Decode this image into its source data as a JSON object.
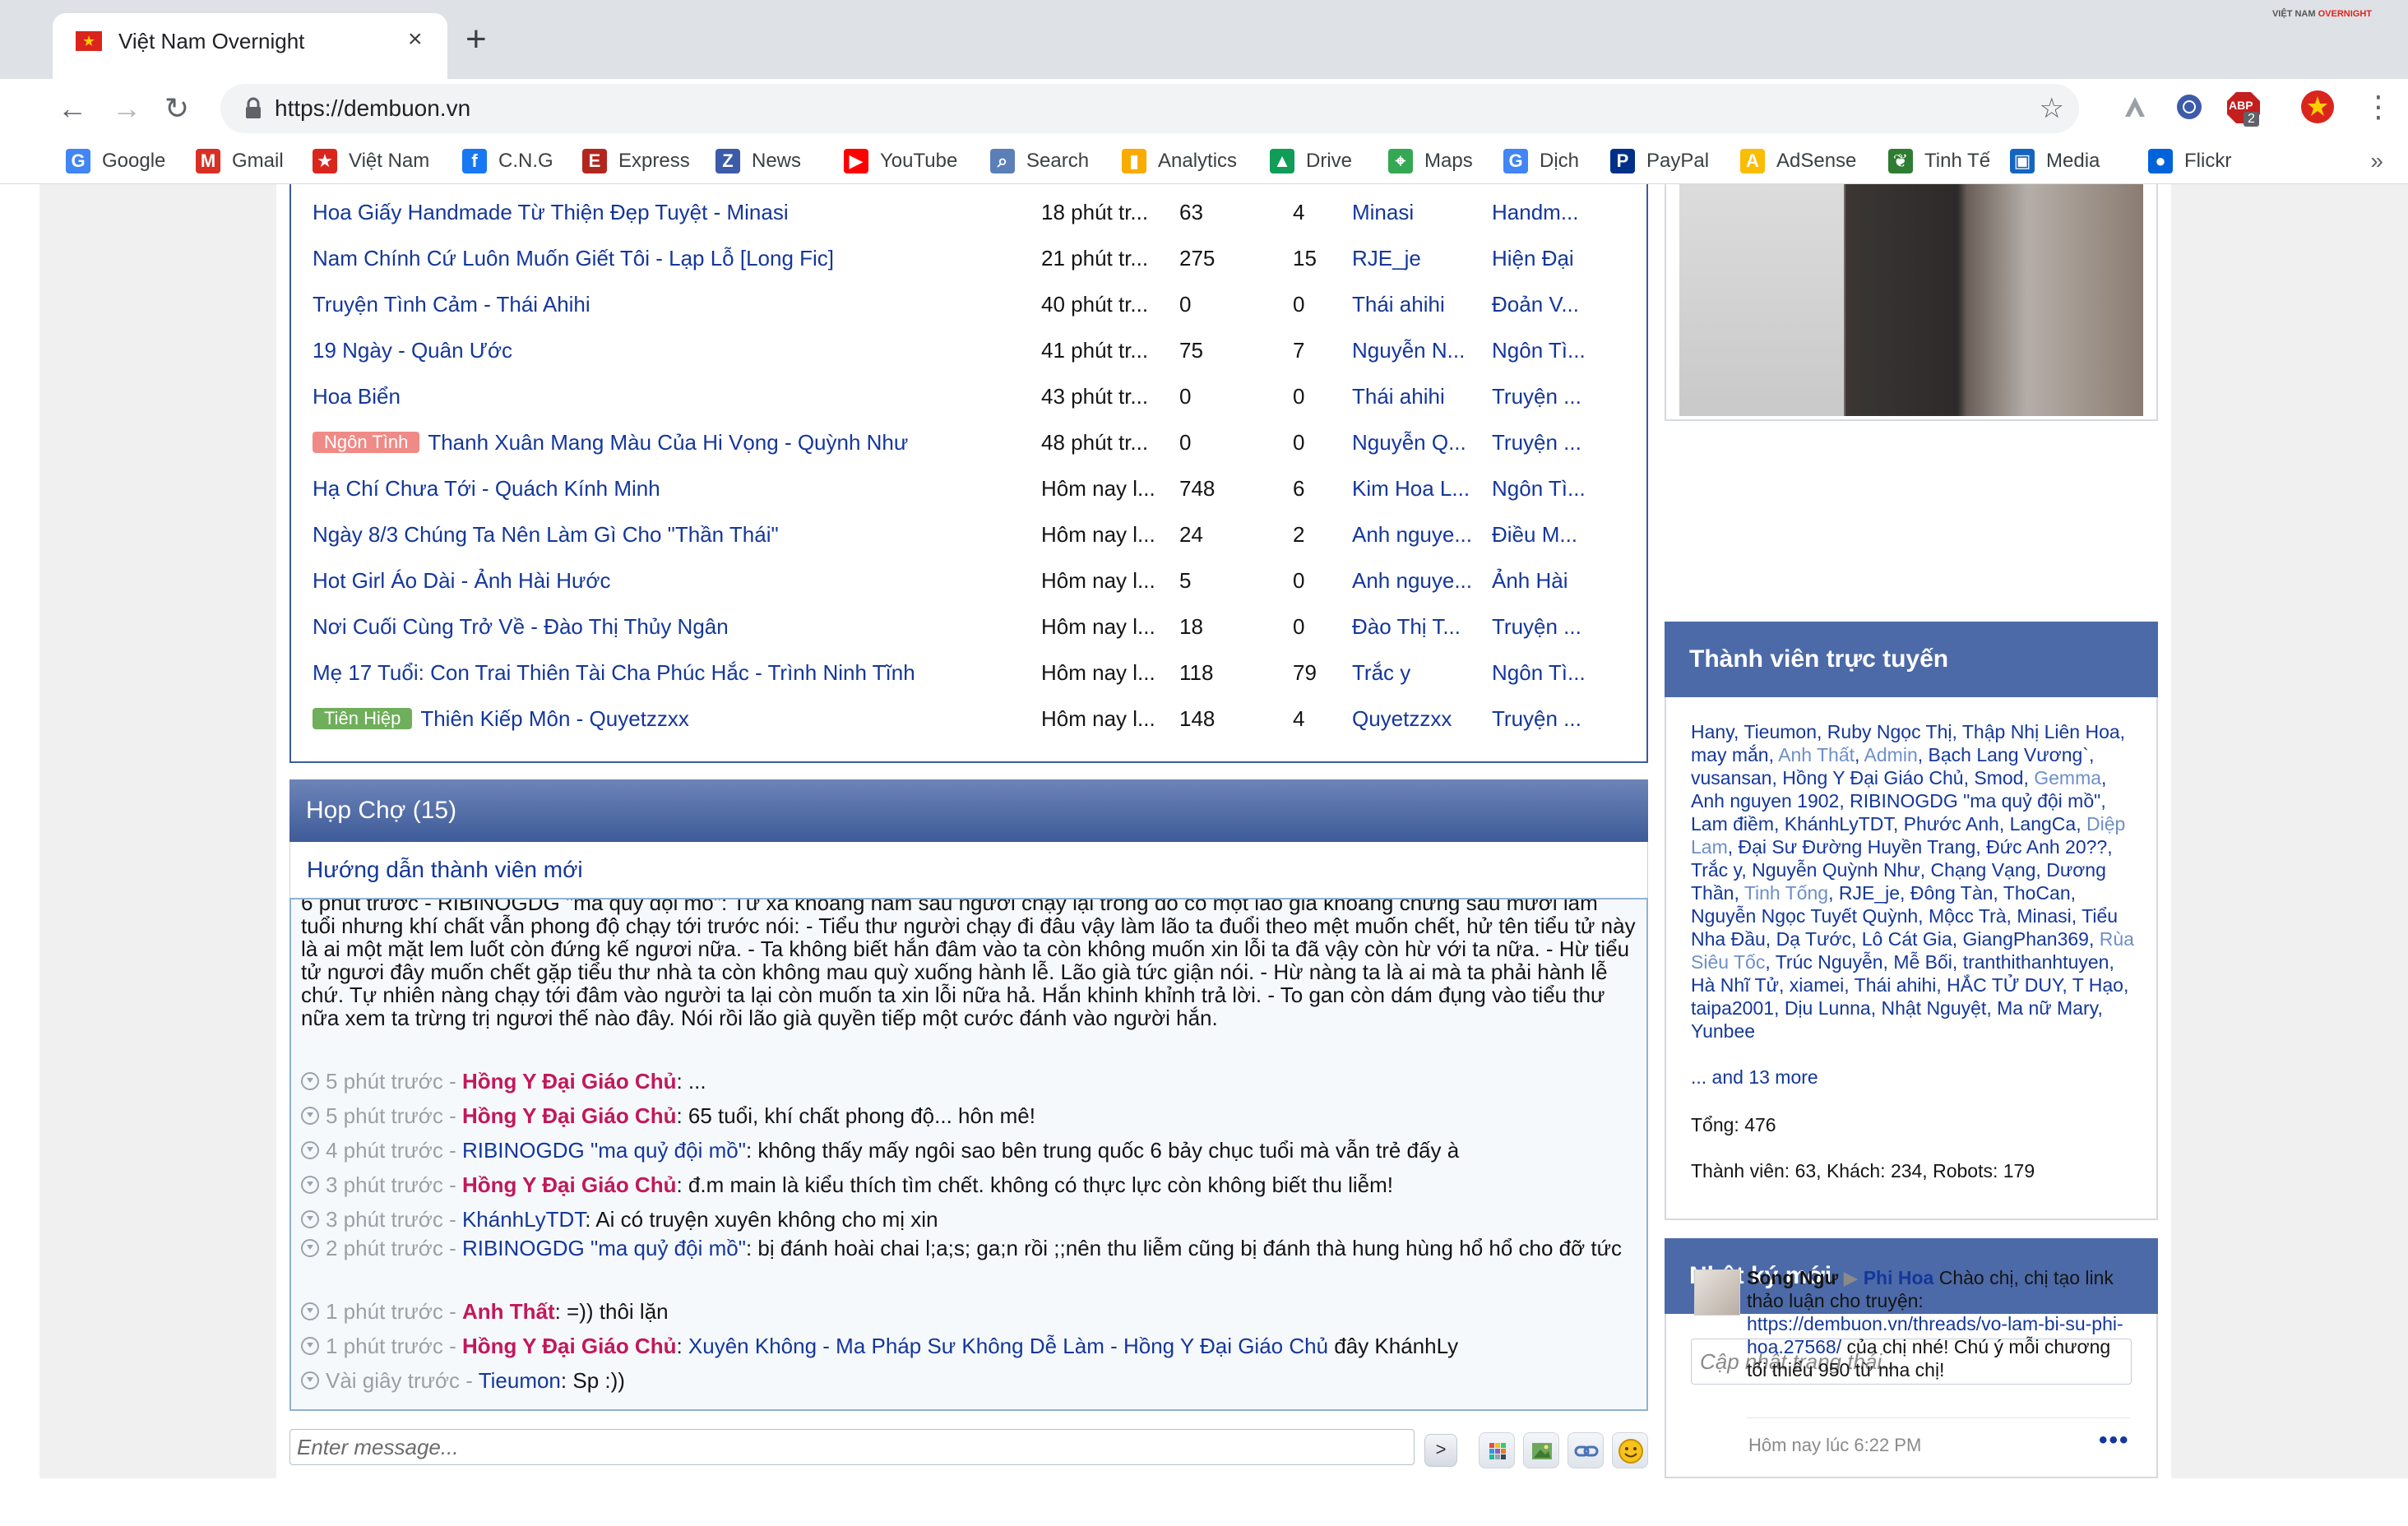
{
  "browser": {
    "tab_title": "Việt Nam Overnight",
    "tab_close": "×",
    "new_tab": "+",
    "url": "https://dembuon.vn",
    "corner_badge_a": "VIỆT NAM",
    "corner_badge_b": "OVERNIGHT",
    "ext_badge_count": "2",
    "ext_badge_label": "ABP",
    "bookmarks_more": "»",
    "bookmarks": [
      {
        "label": "Google",
        "icon": "google-icon",
        "color": "#4285f4",
        "glyph": "G"
      },
      {
        "label": "Gmail",
        "icon": "gmail-icon",
        "color": "#d93025",
        "glyph": "M"
      },
      {
        "label": "Việt Nam",
        "icon": "vietnam-flag-icon",
        "color": "#da251d",
        "glyph": "★"
      },
      {
        "label": "C.N.G",
        "icon": "facebook-icon",
        "color": "#1877f2",
        "glyph": "f"
      },
      {
        "label": "Express",
        "icon": "express-icon",
        "color": "#b3261e",
        "glyph": "E"
      },
      {
        "label": "News",
        "icon": "news-icon",
        "color": "#3c5ba9",
        "glyph": "Z"
      },
      {
        "label": "YouTube",
        "icon": "youtube-icon",
        "color": "#ff0000",
        "glyph": "▶"
      },
      {
        "label": "Search",
        "icon": "search-icon",
        "color": "#5b7fb8",
        "glyph": "⌕"
      },
      {
        "label": "Analytics",
        "icon": "analytics-icon",
        "color": "#f9ab00",
        "glyph": "▮"
      },
      {
        "label": "Drive",
        "icon": "drive-icon",
        "color": "#0f9d58",
        "glyph": "▲"
      },
      {
        "label": "Maps",
        "icon": "maps-icon",
        "color": "#34a853",
        "glyph": "⌖"
      },
      {
        "label": "Dịch",
        "icon": "translate-icon",
        "color": "#4285f4",
        "glyph": "G"
      },
      {
        "label": "PayPal",
        "icon": "paypal-icon",
        "color": "#003087",
        "glyph": "P"
      },
      {
        "label": "AdSense",
        "icon": "adsense-icon",
        "color": "#fbbc04",
        "glyph": "A"
      },
      {
        "label": "Tinh Tế",
        "icon": "tinhte-icon",
        "color": "#2e7d32",
        "glyph": "❦"
      },
      {
        "label": "Media",
        "icon": "media-icon",
        "color": "#1565c0",
        "glyph": "▣"
      },
      {
        "label": "Flickr",
        "icon": "flickr-icon",
        "color": "#0063dc",
        "glyph": "●"
      }
    ]
  },
  "threads": [
    {
      "title": "Hoa Giấy Handmade Từ Thiện Đẹp Tuyệt - Minasi",
      "prefix": "",
      "time": "18 phút tr...",
      "replies": "63",
      "views": "4",
      "user": "Minasi",
      "forum": "Handm..."
    },
    {
      "title": "Nam Chính Cứ Luôn Muốn Giết Tôi - Lạp Lỗ [Long Fic]",
      "prefix": "",
      "time": "21 phút tr...",
      "replies": "275",
      "views": "15",
      "user": "RJE_je",
      "forum": "Hiện Đại"
    },
    {
      "title": "Truyện Tình Cảm - Thái Ahihi",
      "prefix": "",
      "time": "40 phút tr...",
      "replies": "0",
      "views": "0",
      "user": "Thái ahihi",
      "forum": "Đoản V..."
    },
    {
      "title": "19 Ngày - Quân Ước",
      "prefix": "",
      "time": "41 phút tr...",
      "replies": "75",
      "views": "7",
      "user": "Nguyễn N...",
      "forum": "Ngôn Tì..."
    },
    {
      "title": "Hoa Biển",
      "prefix": "",
      "time": "43 phút tr...",
      "replies": "0",
      "views": "0",
      "user": "Thái ahihi",
      "forum": "Truyện ..."
    },
    {
      "title": "Thanh Xuân Mang Màu Của Hi Vọng - Quỳnh Như",
      "prefix": "Ngôn Tình",
      "prefix_color": "#f08a86",
      "time": "48 phút tr...",
      "replies": "0",
      "views": "0",
      "user": "Nguyễn Q...",
      "forum": "Truyện ..."
    },
    {
      "title": "Hạ Chí Chưa Tới - Quách Kính Minh",
      "prefix": "",
      "time": "Hôm nay l...",
      "replies": "748",
      "views": "6",
      "user": "Kim Hoa L...",
      "forum": "Ngôn Tì..."
    },
    {
      "title": "Ngày 8/3 Chúng Ta Nên Làm Gì Cho \"Thần Thái\"",
      "prefix": "",
      "time": "Hôm nay l...",
      "replies": "24",
      "views": "2",
      "user": "Anh nguye...",
      "forum": "Điều M..."
    },
    {
      "title": "Hot Girl Áo Dài - Ảnh Hài Hước",
      "prefix": "",
      "time": "Hôm nay l...",
      "replies": "5",
      "views": "0",
      "user": "Anh nguye...",
      "forum": "Ảnh Hài"
    },
    {
      "title": "Nơi Cuối Cùng Trở Về - Đào Thị Thủy Ngân",
      "prefix": "",
      "time": "Hôm nay l...",
      "replies": "18",
      "views": "0",
      "user": "Đào Thị T...",
      "forum": "Truyện ..."
    },
    {
      "title": "Mẹ 17 Tuổi: Con Trai Thiên Tài Cha Phúc Hắc - Trình Ninh Tĩnh",
      "prefix": "",
      "time": "Hôm nay l...",
      "replies": "118",
      "views": "79",
      "user": "Trắc y",
      "forum": "Ngôn Tì..."
    },
    {
      "title": "Thiên Kiếp Môn - Quyetzzxx",
      "prefix": "Tiên Hiệp",
      "prefix_color": "#6fae5a",
      "time": "Hôm nay l...",
      "replies": "148",
      "views": "4",
      "user": "Quyetzzxx",
      "forum": "Truyện ..."
    }
  ],
  "chat": {
    "title": "Họp Chợ (15)",
    "guide_link": "Hướng dẫn thành viên mới",
    "long_message": "6 phút trước - RIBINOGDG \"ma quỷ đội mồ\": Từ xa khoảng năm sáu người chạy lại trong đó có một lão già khoảng chừng sáu mươi lăm tuổi nhưng khí chất vẫn phong độ chạy tới trước nói: - Tiểu thư người chạy đi đâu vậy làm lão ta đuổi theo mệt muốn chết, hử tên tiểu tử này là ai một mặt lem luốt còn đứng kế ngươi nữa. - Ta không biết hắn đâm vào ta còn không muốn xin lỗi ta đã vậy còn hừ với ta nữa. - Hừ tiểu tử ngươi đây muốn chết gặp tiểu thư nhà ta còn không mau quỳ xuống hành lễ. Lão già tức giận nói. - Hừ nàng ta là ai mà ta phải hành lễ chứ. Tự nhiên nàng chạy tới đâm vào người ta lại còn muốn ta xin lỗi nữa hả. Hắn khinh khỉnh trả lời. - To gan còn dám đụng vào tiểu thư nữa xem ta trừng trị ngươi thế nào đây. Nói rồi lão già quyền tiếp một cước đánh vào người hắn.",
    "messages": [
      {
        "time": "5 phút trước - ",
        "user": "Hồng Y Đại Giáo Chủ",
        "style": "a",
        "text": ": ..."
      },
      {
        "time": "5 phút trước - ",
        "user": "Hồng Y Đại Giáo Chủ",
        "style": "a",
        "text": ": 65 tuổi, khí chất phong độ... hôn mê!"
      },
      {
        "time": "4 phút trước - ",
        "user": "RIBINOGDG \"ma quỷ đội mồ\"",
        "style": "b",
        "text": ": không thấy mấy ngôi sao bên trung quốc 6 bảy chục tuổi mà vẫn trẻ đấy à"
      },
      {
        "time": "3 phút trước - ",
        "user": "Hồng Y Đại Giáo Chủ",
        "style": "a",
        "text": ": đ.m main là kiểu thích tìm chết. không có thực lực còn không biết thu liễm!"
      },
      {
        "time": "3 phút trước - ",
        "user": "KhánhLyTDT",
        "style": "b",
        "text": ": Ai có truyện xuyên không cho mị xin"
      },
      {
        "time": "2 phút trước - ",
        "user": "RIBINOGDG \"ma quỷ đội mồ\"",
        "style": "b",
        "text": ": bị đánh hoài chai l;a;s; ga;n rồi ;;nên thu liễm cũng bị đánh thà hung hùng hổ hổ cho đỡ tức"
      },
      {
        "time": "1 phút trước - ",
        "user": "Anh Thất",
        "style": "a",
        "text": ": =)) thôi lặn"
      },
      {
        "time": "1 phút trước - ",
        "user": "Hồng Y Đại Giáo Chủ",
        "style": "a",
        "text": ": ",
        "link": "Xuyên Không - Ma Pháp Sư Không Dễ Làm - Hồng Y Đại Giáo Chủ",
        "tail": " đây KhánhLy"
      },
      {
        "time": "Vài giây trước - ",
        "user": "Tieumon",
        "style": "b",
        "text": ": Sp :))"
      }
    ],
    "input_placeholder": "Enter message...",
    "send_label": ">"
  },
  "sidebar": {
    "online_title": "Thành viên trực tuyến",
    "online_members": [
      {
        "name": "Hany"
      },
      {
        "name": "Tieumon"
      },
      {
        "name": "Ruby Ngọc Thị"
      },
      {
        "name": "Thập Nhị Liên Hoa"
      },
      {
        "name": "may mắn"
      },
      {
        "name": "Anh Thất",
        "staff": true
      },
      {
        "name": "Admin",
        "staff": true
      },
      {
        "name": "Bạch Lang Vương`"
      },
      {
        "name": "vusansan"
      },
      {
        "name": "Hồng Y Đại Giáo Chủ"
      },
      {
        "name": "Smod"
      },
      {
        "name": "Gemma",
        "staff": true
      },
      {
        "name": "Anh nguyen 1902"
      },
      {
        "name": "RIBINOGDG \"ma quỷ đội mồ\""
      },
      {
        "name": "Lam điềm"
      },
      {
        "name": "KhánhLyTDT"
      },
      {
        "name": "Phước Anh"
      },
      {
        "name": "LangCa"
      },
      {
        "name": "Diệp Lam",
        "staff": true
      },
      {
        "name": "Đại Sư Đường Huyền Trang"
      },
      {
        "name": "Đức Anh 20??"
      },
      {
        "name": "Trắc y"
      },
      {
        "name": "Nguyễn Quỳnh Như"
      },
      {
        "name": "Chạng Vạng"
      },
      {
        "name": "Dương Thần"
      },
      {
        "name": "Tinh Tống",
        "staff": true
      },
      {
        "name": "RJE_je"
      },
      {
        "name": "Đông Tàn"
      },
      {
        "name": "ThoCan"
      },
      {
        "name": "Nguyễn Ngọc Tuyết Quỳnh"
      },
      {
        "name": "Mộcc Trà"
      },
      {
        "name": "Minasi"
      },
      {
        "name": "Tiểu Nha Đầu"
      },
      {
        "name": "Dạ Tước"
      },
      {
        "name": "Lô Cát Gia"
      },
      {
        "name": "GiangPhan369"
      },
      {
        "name": "Rùa Siêu Tốc",
        "staff": true
      },
      {
        "name": "Trúc Nguyễn"
      },
      {
        "name": "Mễ Bối"
      },
      {
        "name": "tranthithanhtuyen"
      },
      {
        "name": "Hà Nhĩ Tử"
      },
      {
        "name": "xiamei"
      },
      {
        "name": "Thái ahihi"
      },
      {
        "name": "HẮC TỬ DUY"
      },
      {
        "name": "T Hạo"
      },
      {
        "name": "taipa2001"
      },
      {
        "name": "Dịu Lunna"
      },
      {
        "name": "Nhật Nguyệt"
      },
      {
        "name": "Ma nữ Mary"
      },
      {
        "name": "Yunbee"
      }
    ],
    "online_more": "... and 13 more",
    "online_total": "Tổng: 476",
    "online_stats": "Thành viên: 63, Khách: 234, Robots: 179",
    "diary_title": "Nhật ký mới",
    "status_placeholder": "Cập nhật trạng thái...",
    "diary_user": "Song Ngư",
    "diary_target": "Phi Hoa",
    "diary_text_1": " Chào chị, chị tạo link thảo luận cho truyện: ",
    "diary_link": "https://dembuon.vn/threads/vo-lam-bi-su-phi-hoa.27568/",
    "diary_text_2": " của chị nhé! Chú ý mỗi chương tối thiểu 950 từ nha chị!",
    "diary_time": "Hôm nay lúc 6:22 PM",
    "diary_more": "•••"
  }
}
